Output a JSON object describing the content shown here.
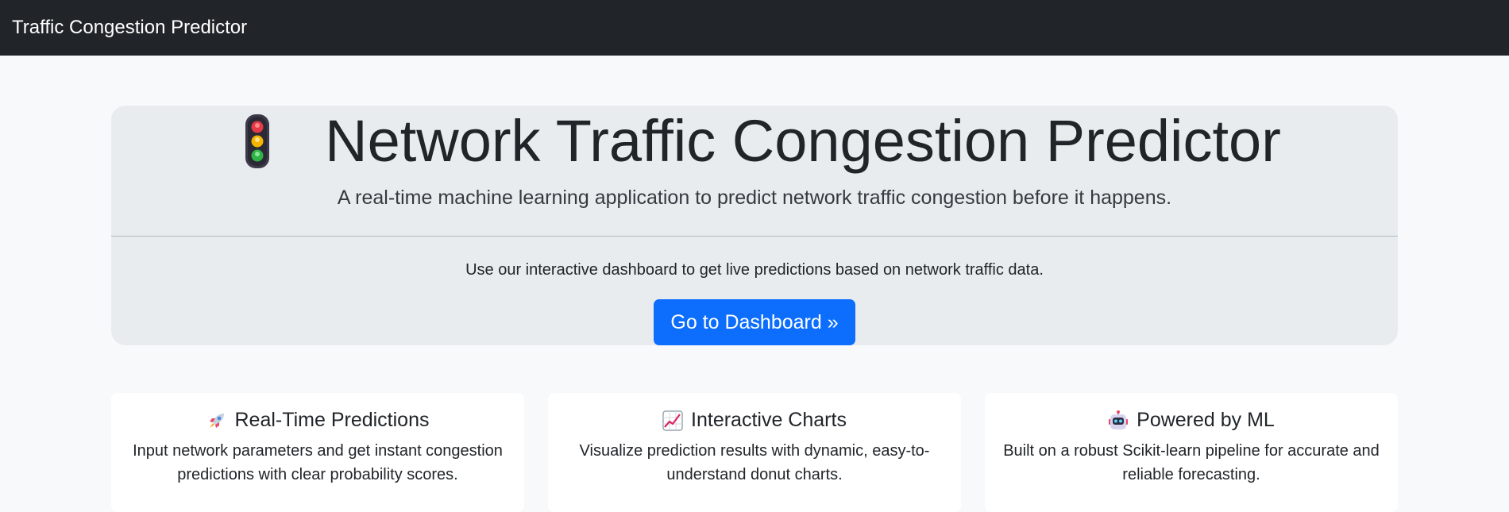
{
  "navbar": {
    "brand": "Traffic Congestion Predictor"
  },
  "hero": {
    "icon": "traffic-light-icon",
    "title": "Network Traffic Congestion Predictor",
    "lead": "A real-time machine learning application to predict network traffic congestion before it happens.",
    "text": "Use our interactive dashboard to get live predictions based on network traffic data.",
    "button_label": "Go to Dashboard »"
  },
  "features": [
    {
      "icon": "rocket-icon",
      "title": "Real-Time Predictions",
      "text": "Input network parameters and get instant congestion predictions with clear probability scores."
    },
    {
      "icon": "chart-increasing-icon",
      "title": "Interactive Charts",
      "text": "Visualize prediction results with dynamic, easy-to-understand donut charts."
    },
    {
      "icon": "robot-icon",
      "title": "Powered by ML",
      "text": "Built on a robust Scikit-learn pipeline for accurate and reliable forecasting."
    }
  ],
  "colors": {
    "navbar_bg": "#212529",
    "primary": "#0d6efd",
    "hero_bg": "#e9ecef",
    "page_bg": "#f8f9fa"
  }
}
